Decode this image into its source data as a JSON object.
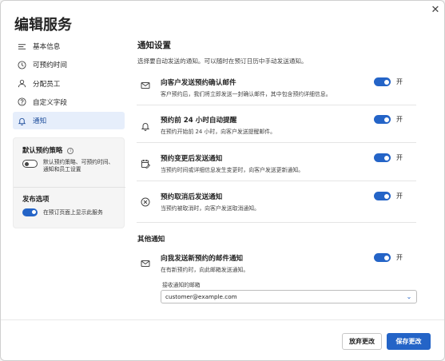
{
  "dialog": {
    "title": "编辑服务",
    "close_glyph": "✕"
  },
  "nav": {
    "items": [
      {
        "label": "基本信息",
        "icon": "list-icon",
        "active": false
      },
      {
        "label": "可预约时间",
        "icon": "clock-icon",
        "active": false
      },
      {
        "label": "分配员工",
        "icon": "person-icon",
        "active": false
      },
      {
        "label": "自定义字段",
        "icon": "help-circle-icon",
        "active": false
      },
      {
        "label": "通知",
        "icon": "bell-icon",
        "active": true
      }
    ]
  },
  "policy_card": {
    "default_policy_title": "默认预约策略",
    "default_policy_text_line1": "默认预约策略、可预约时间、",
    "default_policy_text_line2": "通知和员工设置",
    "default_policy_on": false,
    "publish_title": "发布选项",
    "publish_text": "在预订页面上显示此服务",
    "publish_on": true
  },
  "notifications": {
    "title": "通知设置",
    "subtitle": "选择要自动发送的通知。可以随时在预订日历中手动发送通知。",
    "toggle_on_label": "开",
    "rows": [
      {
        "icon": "mail-icon",
        "title": "向客户发送预约确认邮件",
        "desc": "客户预约后，我们将立即发送一封确认邮件，其中包含预约详细信息。",
        "on": true
      },
      {
        "icon": "bell-icon",
        "title": "预约前 24 小时自动提醒",
        "desc": "在预约开始前 24 小时，向客户发送提醒邮件。",
        "on": true
      },
      {
        "icon": "edit-calendar-icon",
        "title": "预约变更后发送通知",
        "desc": "当预约时间或详细信息发生变更时，向客户发送更新通知。",
        "on": true
      },
      {
        "icon": "cancel-circle-icon",
        "title": "预约取消后发送通知",
        "desc": "当预约被取消时，向客户发送取消通知。",
        "on": true
      }
    ]
  },
  "other": {
    "title": "其他通知",
    "row": {
      "icon": "mail-icon",
      "title": "向我发送新预约的邮件通知",
      "desc": "在有新预约时，向此邮箱发送通知。",
      "on": true
    },
    "email_label": "接收通知的邮箱",
    "email_value": "customer@example.com"
  },
  "footer": {
    "discard_label": "放弃更改",
    "save_label": "保存更改"
  },
  "colors": {
    "accent": "#2464c7",
    "active_nav_bg": "#e6eefb"
  }
}
